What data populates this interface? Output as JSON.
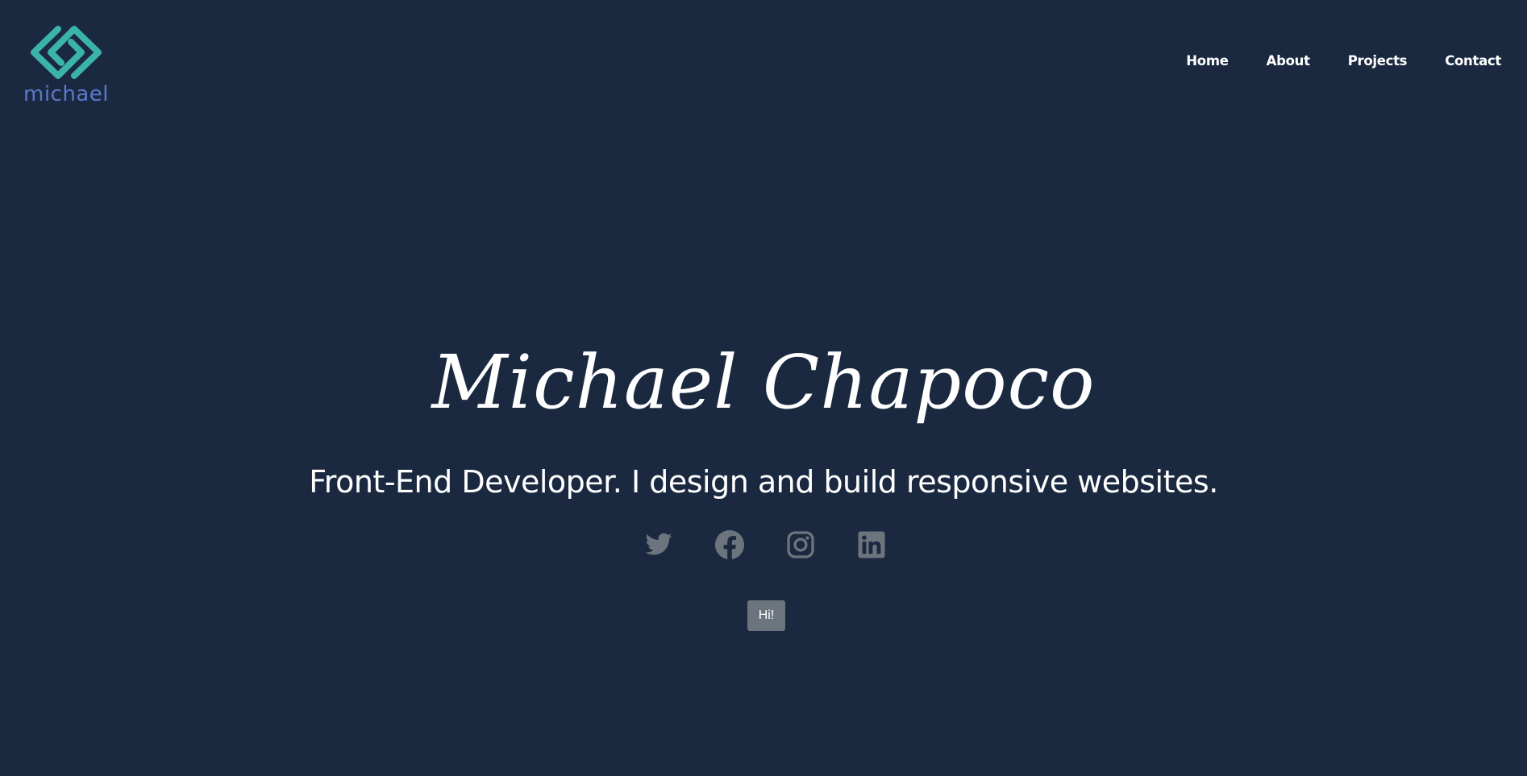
{
  "logo": {
    "text": "michael",
    "mark_color": "#3bb3a8",
    "text_color": "#5b79c9"
  },
  "nav": {
    "items": [
      {
        "label": "Home"
      },
      {
        "label": "About"
      },
      {
        "label": "Projects"
      },
      {
        "label": "Contact"
      }
    ]
  },
  "hero": {
    "name": "Michael Chapoco",
    "tagline": "Front-End Developer. I design and build responsive websites."
  },
  "socials": {
    "icons": [
      "twitter-icon",
      "facebook-icon",
      "instagram-icon",
      "linkedin-icon"
    ],
    "icon_color": "#6c757d"
  },
  "button": {
    "label": "Hi!"
  },
  "colors": {
    "background": "#1b2940",
    "text": "#ffffff"
  }
}
